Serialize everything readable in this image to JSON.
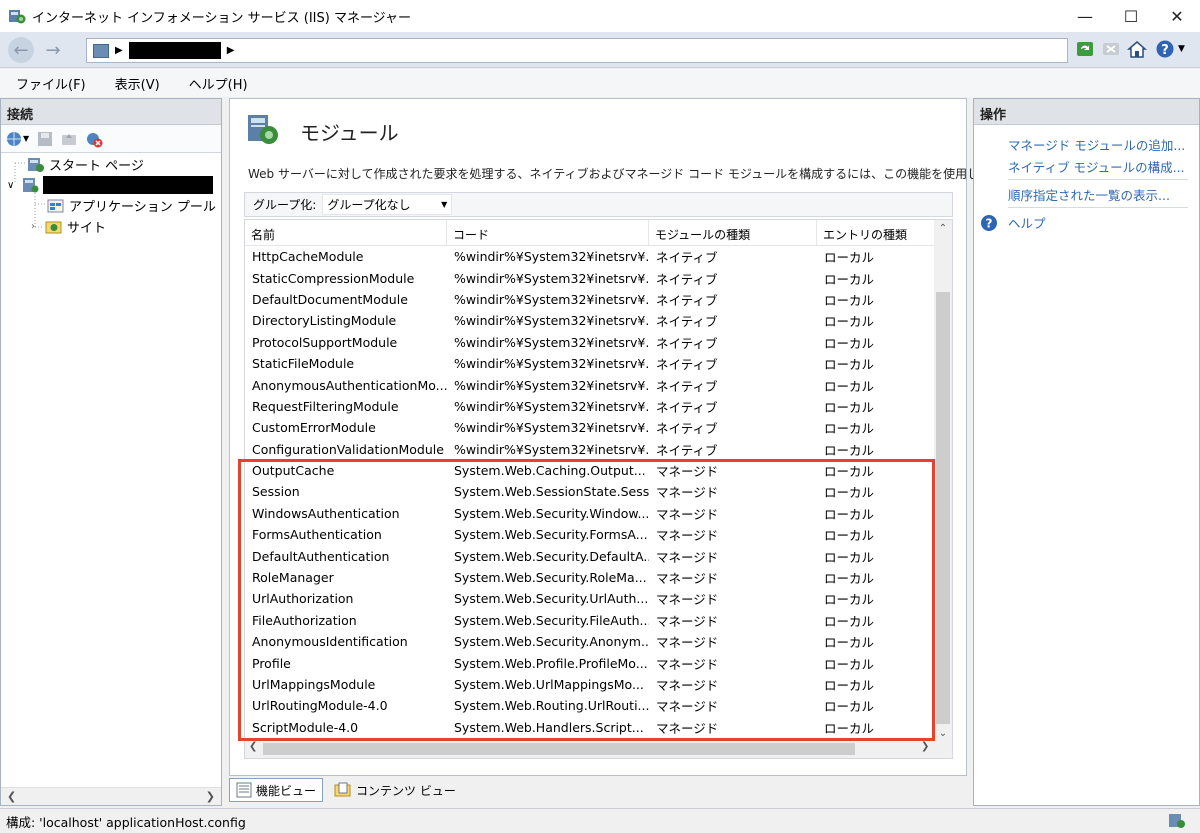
{
  "window": {
    "title": "インターネット インフォメーション サービス (IIS) マネージャー",
    "minimize": "—",
    "maximize": "☐",
    "close": "✕"
  },
  "address": {
    "separator": "▶"
  },
  "menu": [
    "ファイル(F)",
    "表示(V)",
    "ヘルプ(H)"
  ],
  "connections": {
    "header": "接続",
    "tree": {
      "start_page": "スタート ページ",
      "app_pools": "アプリケーション プール",
      "sites": "サイト"
    }
  },
  "center": {
    "title": "モジュール",
    "description": "Web サーバーに対して作成された要求を処理する、ネイティブおよびマネージド コード モジュールを構成するには、この機能を使用します。",
    "group_label": "グループ化:",
    "group_value": "グループ化なし",
    "columns": [
      "名前",
      "コード",
      "モジュールの種類",
      "エントリの種類"
    ],
    "rows": [
      [
        "HttpCacheModule",
        "%windir%¥System32¥inetsrv¥...",
        "ネイティブ",
        "ローカル"
      ],
      [
        "StaticCompressionModule",
        "%windir%¥System32¥inetsrv¥...",
        "ネイティブ",
        "ローカル"
      ],
      [
        "DefaultDocumentModule",
        "%windir%¥System32¥inetsrv¥...",
        "ネイティブ",
        "ローカル"
      ],
      [
        "DirectoryListingModule",
        "%windir%¥System32¥inetsrv¥...",
        "ネイティブ",
        "ローカル"
      ],
      [
        "ProtocolSupportModule",
        "%windir%¥System32¥inetsrv¥...",
        "ネイティブ",
        "ローカル"
      ],
      [
        "StaticFileModule",
        "%windir%¥System32¥inetsrv¥...",
        "ネイティブ",
        "ローカル"
      ],
      [
        "AnonymousAuthenticationMo...",
        "%windir%¥System32¥inetsrv¥...",
        "ネイティブ",
        "ローカル"
      ],
      [
        "RequestFilteringModule",
        "%windir%¥System32¥inetsrv¥...",
        "ネイティブ",
        "ローカル"
      ],
      [
        "CustomErrorModule",
        "%windir%¥System32¥inetsrv¥...",
        "ネイティブ",
        "ローカル"
      ],
      [
        "ConfigurationValidationModule",
        "%windir%¥System32¥inetsrv¥...",
        "ネイティブ",
        "ローカル"
      ],
      [
        "OutputCache",
        "System.Web.Caching.Output...",
        "マネージド",
        "ローカル"
      ],
      [
        "Session",
        "System.Web.SessionState.Sess...",
        "マネージド",
        "ローカル"
      ],
      [
        "WindowsAuthentication",
        "System.Web.Security.Window...",
        "マネージド",
        "ローカル"
      ],
      [
        "FormsAuthentication",
        "System.Web.Security.FormsA...",
        "マネージド",
        "ローカル"
      ],
      [
        "DefaultAuthentication",
        "System.Web.Security.DefaultA...",
        "マネージド",
        "ローカル"
      ],
      [
        "RoleManager",
        "System.Web.Security.RoleMa...",
        "マネージド",
        "ローカル"
      ],
      [
        "UrlAuthorization",
        "System.Web.Security.UrlAuth...",
        "マネージド",
        "ローカル"
      ],
      [
        "FileAuthorization",
        "System.Web.Security.FileAuth...",
        "マネージド",
        "ローカル"
      ],
      [
        "AnonymousIdentification",
        "System.Web.Security.Anonym...",
        "マネージド",
        "ローカル"
      ],
      [
        "Profile",
        "System.Web.Profile.ProfileMo...",
        "マネージド",
        "ローカル"
      ],
      [
        "UrlMappingsModule",
        "System.Web.UrlMappingsMo...",
        "マネージド",
        "ローカル"
      ],
      [
        "UrlRoutingModule-4.0",
        "System.Web.Routing.UrlRouti...",
        "マネージド",
        "ローカル"
      ],
      [
        "ScriptModule-4.0",
        "System.Web.Handlers.Script...",
        "マネージド",
        "ローカル"
      ]
    ],
    "highlight_color": "#e8412c",
    "view_tabs": [
      "機能ビュー",
      "コンテンツ ビュー"
    ]
  },
  "actions": {
    "header": "操作",
    "items": [
      "マネージド モジュールの追加...",
      "ネイティブ モジュールの構成...",
      "順序指定された一覧の表示...",
      "ヘルプ"
    ]
  },
  "status": {
    "text": "構成: 'localhost' applicationHost.config"
  }
}
